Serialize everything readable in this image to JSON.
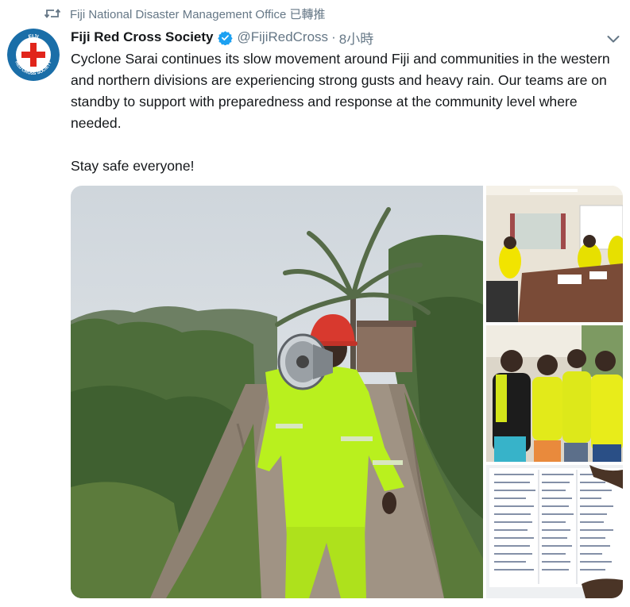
{
  "retweet": {
    "icon": "retweet-icon",
    "text": "Fiji National Disaster Management Office 已轉推"
  },
  "author": {
    "name": "Fiji Red Cross Society",
    "handle": "@FijiRedCross",
    "separator": "·",
    "time": "8小時",
    "verified": true,
    "avatar": {
      "top_text": "FIJI",
      "bottom_text": "RED CROSS SOCIETY",
      "ring_color": "#1a6ea8",
      "cross_color": "#e1251b"
    }
  },
  "tweet": {
    "text": "Cyclone Sarai continues its slow movement around Fiji and communities in the western and northern divisions are experiencing strong gusts and heavy rain. Our teams are on standby to support with preparedness and response at the community level where needed.\n\nStay safe everyone!"
  },
  "colors": {
    "text": "#14171a",
    "muted": "#657786",
    "verified": "#1da1f2"
  }
}
